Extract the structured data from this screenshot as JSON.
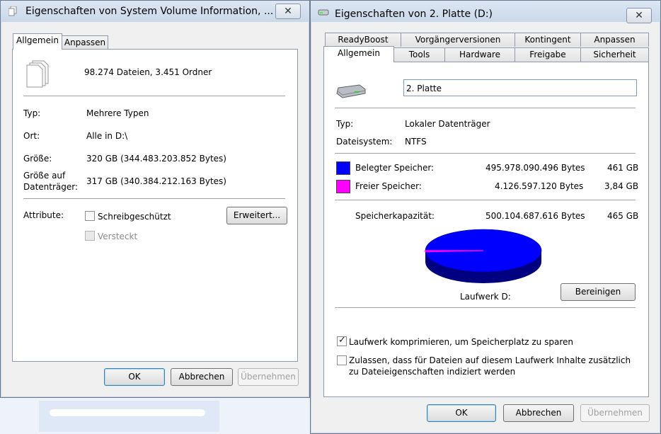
{
  "left_window": {
    "title": "Eigenschaften von System Volume Information, ...",
    "close_label": "✕",
    "tabs": [
      "Allgemein",
      "Anpassen"
    ],
    "summary": "98.274 Dateien, 3.451 Ordner",
    "rows": [
      {
        "label": "Typ:",
        "value": "Mehrere Typen"
      },
      {
        "label": "Ort:",
        "value": "Alle in D:\\"
      },
      {
        "label": "Größe:",
        "value": "320 GB (344.483.203.852 Bytes)"
      },
      {
        "label": "Größe auf Datenträger:",
        "value": "317 GB (340.384.212.163 Bytes)"
      }
    ],
    "size_on_disk_label_line1": "Größe auf",
    "size_on_disk_label_line2": "Datenträger:",
    "attributes_label": "Attribute:",
    "readonly_label": "Schreibgeschützt",
    "hidden_label": "Versteckt",
    "advanced_button": "Erweitert...",
    "ok_button": "OK",
    "cancel_button": "Abbrechen",
    "apply_button": "Übernehmen"
  },
  "right_window": {
    "title": "Eigenschaften von 2. Platte (D:)",
    "close_label": "✕",
    "tabs_row1": [
      "ReadyBoost",
      "Vorgängerversionen",
      "Kontingent",
      "Anpassen"
    ],
    "tabs_row2": [
      "Allgemein",
      "Tools",
      "Hardware",
      "Freigabe",
      "Sicherheit"
    ],
    "drive_name_value": "2. Platte",
    "type_label": "Typ:",
    "type_value": "Lokaler Datenträger",
    "fs_label": "Dateisystem:",
    "fs_value": "NTFS",
    "used_label": "Belegter Speicher:",
    "used_bytes": "495.978.090.496 Bytes",
    "used_gb": "461 GB",
    "free_label": "Freier Speicher:",
    "free_bytes": "4.126.597.120 Bytes",
    "free_gb": "3,84 GB",
    "capacity_label": "Speicherkapazität:",
    "capacity_bytes": "500.104.687.616 Bytes",
    "capacity_gb": "465 GB",
    "drive_label": "Laufwerk D:",
    "cleanup_button": "Bereinigen",
    "compress_label": "Laufwerk komprimieren, um Speicherplatz zu sparen",
    "index_label_line1": "Zulassen, dass für Dateien auf diesem Laufwerk Inhalte zusätzlich",
    "index_label_line2": "zu Dateieigenschaften indiziert werden",
    "compress_checked": true,
    "index_checked": false,
    "ok_button": "OK",
    "cancel_button": "Abbrechen",
    "apply_button": "Übernehmen",
    "colors": {
      "used": "#0000ff",
      "free": "#ff00ff"
    }
  },
  "chart_data": {
    "type": "pie",
    "categories": [
      "Belegter Speicher",
      "Freier Speicher"
    ],
    "values": [
      495978090496,
      4126597120
    ],
    "colors": [
      "#0000ff",
      "#ff00ff"
    ],
    "title": "Laufwerk D:"
  }
}
